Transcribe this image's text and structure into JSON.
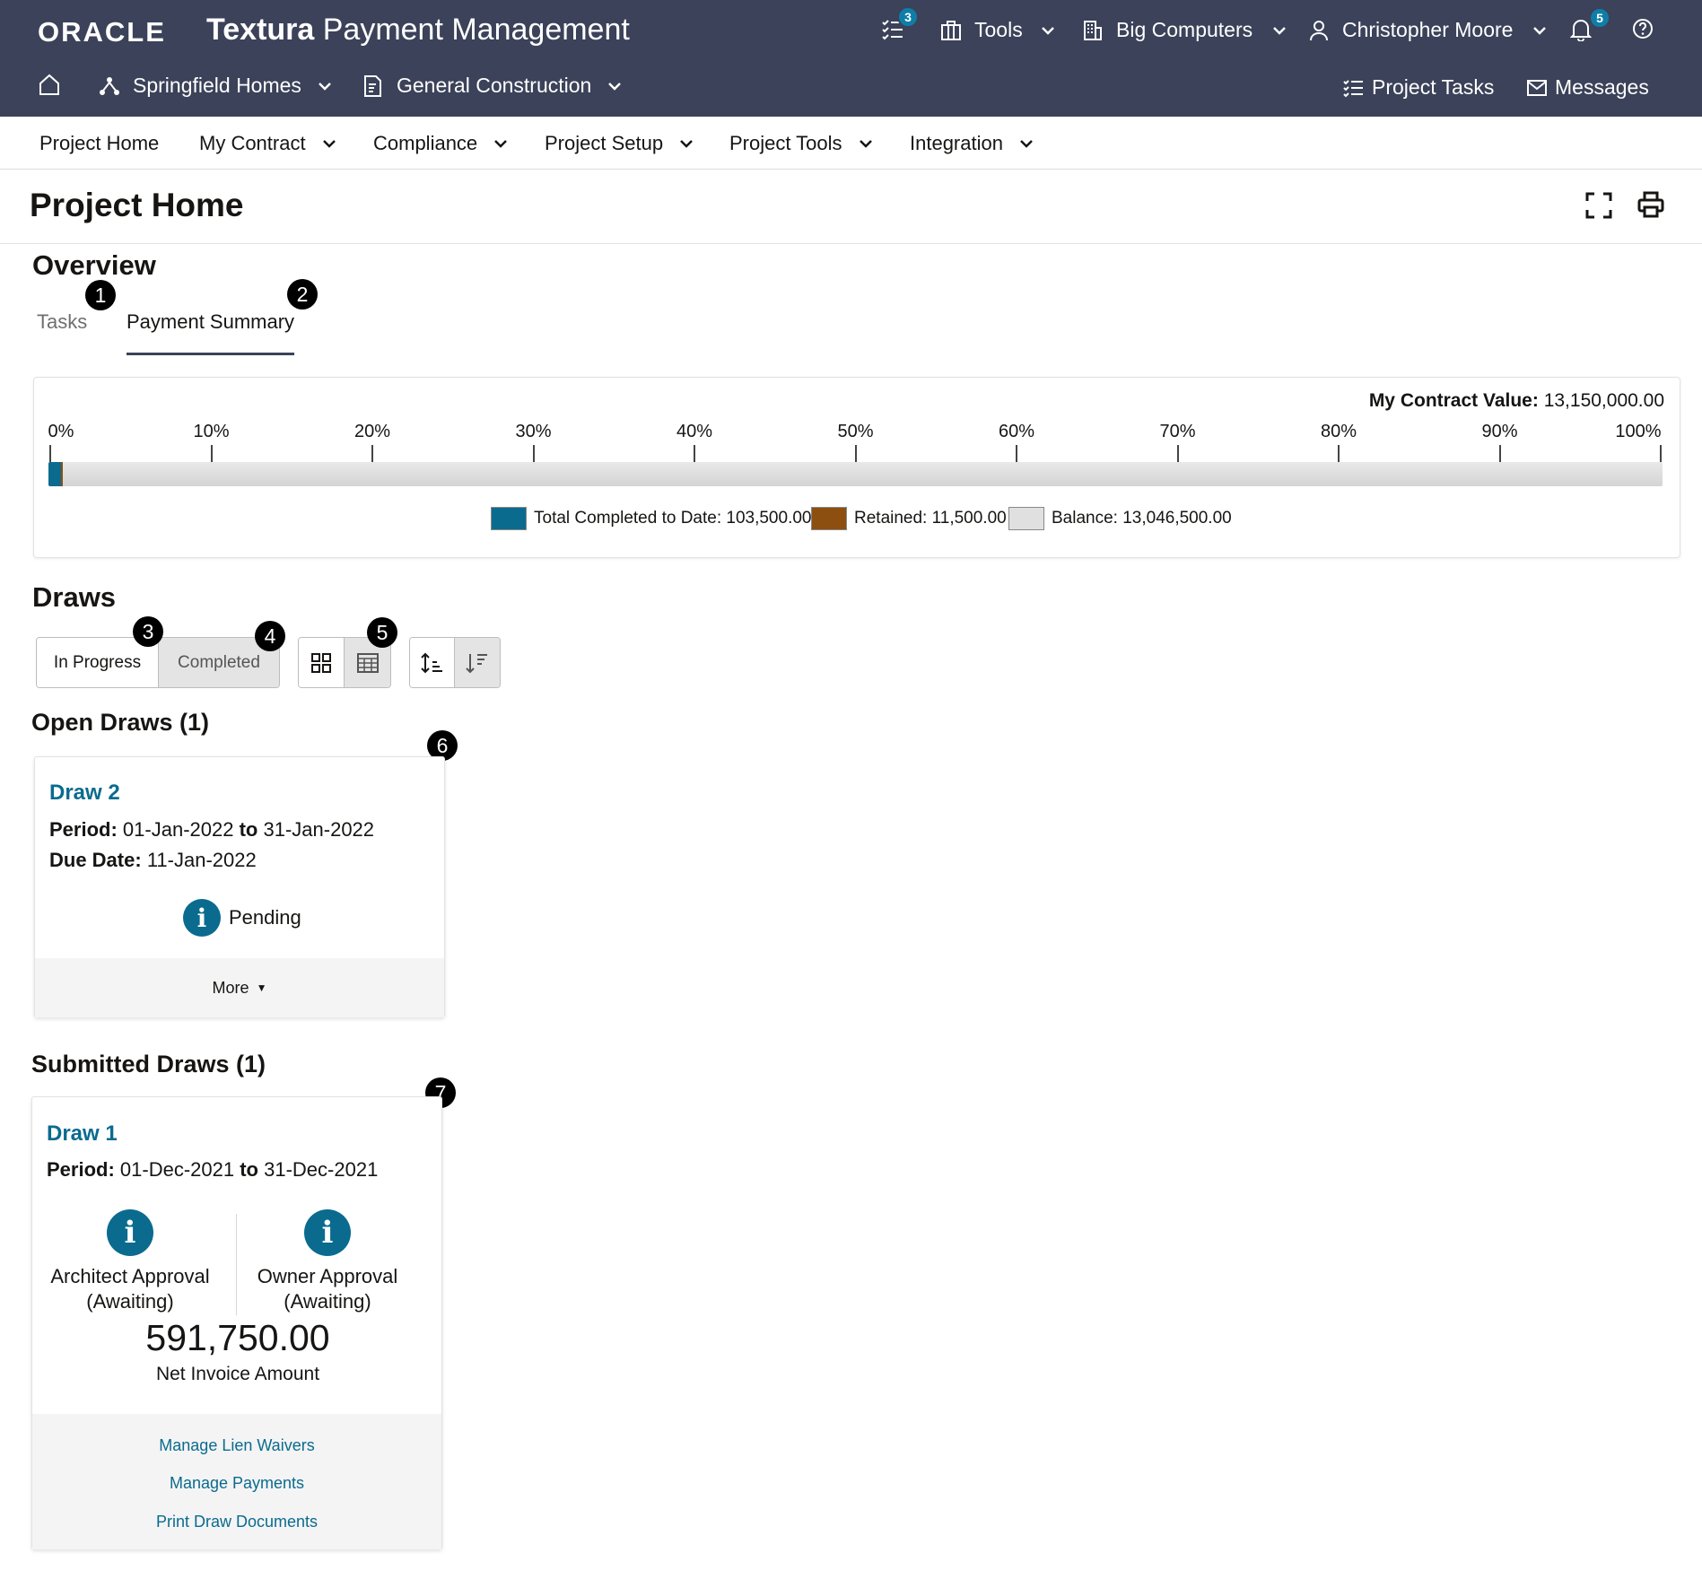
{
  "app": {
    "logo": "ORACLE",
    "name_bold": "Textura",
    "name_rest": " Payment Management"
  },
  "topbar": {
    "tasks_badge": "3",
    "tools": "Tools",
    "company": "Big Computers",
    "user": "Christopher Moore",
    "notifications_badge": "5"
  },
  "project_bar": {
    "project": "Springfield Homes",
    "contract": "General Construction",
    "project_tasks": "Project Tasks",
    "messages": "Messages"
  },
  "nav": {
    "items": [
      {
        "label": "Project Home"
      },
      {
        "label": "My Contract"
      },
      {
        "label": "Compliance"
      },
      {
        "label": "Project Setup"
      },
      {
        "label": "Project Tools"
      },
      {
        "label": "Integration"
      }
    ]
  },
  "page": {
    "title": "Project Home"
  },
  "overview": {
    "title": "Overview",
    "tabs": [
      {
        "label": "Tasks",
        "selected": false
      },
      {
        "label": "Payment Summary",
        "selected": true
      }
    ],
    "markers": [
      "1",
      "2"
    ]
  },
  "summary": {
    "contract_value_label": "My Contract Value:",
    "contract_value": "13,150,000.00",
    "ticks": [
      "0%",
      "10%",
      "20%",
      "30%",
      "40%",
      "50%",
      "60%",
      "70%",
      "80%",
      "90%",
      "100%"
    ],
    "completed_fraction": 0.00787,
    "retained_fraction": 0.00087,
    "legend": [
      {
        "label": "Total Completed to Date: 103,500.00",
        "color": "#0a6b8f"
      },
      {
        "label": "Retained: 11,500.00",
        "color": "#8c4f10"
      },
      {
        "label": "Balance: 13,046,500.00",
        "color": "#e0e0e0"
      }
    ]
  },
  "draws": {
    "title": "Draws",
    "filter_in_progress": "In Progress",
    "filter_completed": "Completed",
    "markers": [
      "3",
      "4",
      "5",
      "6",
      "7"
    ],
    "open_title": "Open Draws (1)",
    "open_card": {
      "name": "Draw 2",
      "period_label": "Period:",
      "period_start": "01-Jan-2022",
      "period_to": "to",
      "period_end": "31-Jan-2022",
      "due_label": "Due Date:",
      "due_date": "11-Jan-2022",
      "status": "Pending",
      "more": "More"
    },
    "submitted_title": "Submitted Draws (1)",
    "submitted_card": {
      "name": "Draw 1",
      "period_label": "Period:",
      "period_start": "01-Dec-2021",
      "period_to": "to",
      "period_end": "31-Dec-2021",
      "approval_1_line1": "Architect Approval",
      "approval_1_line2": "(Awaiting)",
      "approval_2_line1": "Owner Approval",
      "approval_2_line2": "(Awaiting)",
      "amount": "591,750.00",
      "amount_label": "Net Invoice Amount",
      "links": [
        "Manage Lien Waivers",
        "Manage Payments",
        "Print Draw Documents"
      ]
    }
  },
  "colors": {
    "header_bg": "#3b4259",
    "accent": "#0a6b8f",
    "badge": "#0e7ea8",
    "retained": "#8c4f10",
    "balance": "#e0e0e0"
  }
}
